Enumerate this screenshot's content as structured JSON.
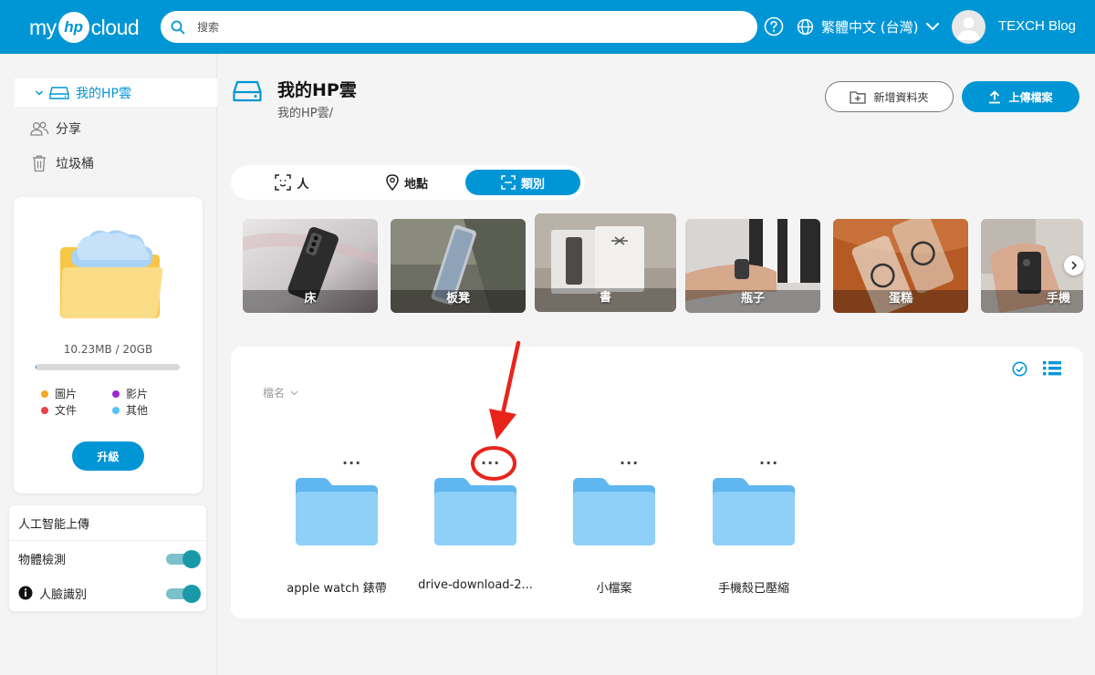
{
  "header": {
    "logo_pre": "my",
    "logo_mark": "hp",
    "logo_post": "cloud",
    "search_placeholder": "搜索",
    "language": "繁體中文 (台灣)",
    "username": "TEXCH Blog"
  },
  "sidebar": {
    "items": [
      {
        "label": "我的HP雲",
        "icon": "drive-icon",
        "active": true
      },
      {
        "label": "分享",
        "icon": "people-icon",
        "active": false
      },
      {
        "label": "垃圾桶",
        "icon": "trash-icon",
        "active": false
      }
    ],
    "storage": {
      "text": "10.23MB / 20GB",
      "used_fraction": 0.0005
    },
    "legend": [
      {
        "label": "圖片",
        "color": "#f5a623"
      },
      {
        "label": "影片",
        "color": "#9b27d6"
      },
      {
        "label": "文件",
        "color": "#e8414b"
      },
      {
        "label": "其他",
        "color": "#4fc3f7"
      }
    ],
    "upgrade_label": "升級",
    "ai": {
      "title": "人工智能上傳",
      "toggles": [
        {
          "label": "物體檢測",
          "on": true
        },
        {
          "label": "人臉識別",
          "on": true
        }
      ]
    }
  },
  "main": {
    "title": "我的HP雲",
    "breadcrumb": "我的HP雲/",
    "new_folder_label": "新增資料夾",
    "upload_label": "上傳檔案",
    "category_tabs": [
      {
        "label": "人",
        "icon": "face-scan-icon",
        "active": false
      },
      {
        "label": "地點",
        "icon": "location-icon",
        "active": false
      },
      {
        "label": "類別",
        "icon": "category-scan-icon",
        "active": true
      }
    ],
    "categories": [
      "床",
      "板凳",
      "書",
      "瓶子",
      "蛋糕",
      "手機"
    ],
    "sort_label": "檔名",
    "files": [
      {
        "name": "apple watch 錶帶",
        "more": "..."
      },
      {
        "name": "drive-download-2...",
        "more": "..."
      },
      {
        "name": "小檔案",
        "more": "..."
      },
      {
        "name": "手機殼已壓縮",
        "more": "..."
      }
    ]
  },
  "colors": {
    "brand": "#0096d6",
    "folder": "#7ec8f5",
    "annotation": "#e8241a"
  }
}
